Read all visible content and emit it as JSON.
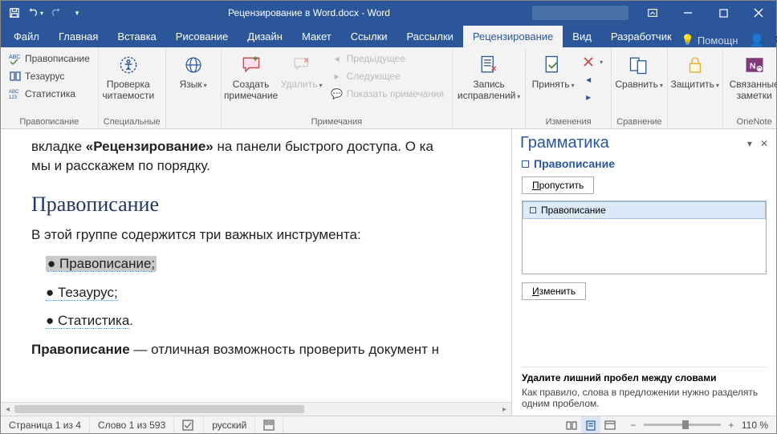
{
  "title": "Рецензирование в Word.docx - Word",
  "menutabs": [
    "Файл",
    "Главная",
    "Вставка",
    "Рисование",
    "Дизайн",
    "Макет",
    "Ссылки",
    "Рассылки",
    "Рецензирование",
    "Вид",
    "Разработчик"
  ],
  "active_tab": "Рецензирование",
  "tell_me": "Помощн",
  "ribbon": {
    "g1": {
      "spelling": "Правописание",
      "thesaurus": "Тезаурус",
      "stats": "Статистика",
      "label": "Правописание"
    },
    "g2": {
      "btn": "Проверка читаемости",
      "label": "Специальные"
    },
    "g3": {
      "btn": "Язык"
    },
    "g4": {
      "new": "Создать примечание",
      "del": "Удалить",
      "prev": "Предыдущее",
      "next": "Следующее",
      "show": "Показать примечания",
      "label": "Примечания"
    },
    "g5": {
      "track": "Запись исправлений"
    },
    "g6": {
      "accept": "Принять",
      "label": "Изменения"
    },
    "g7": {
      "compare": "Сравнить",
      "label": "Сравнение"
    },
    "g8": {
      "protect": "Защитить"
    },
    "g9": {
      "onenote": "Связанные заметки",
      "label": "OneNote"
    }
  },
  "document": {
    "line1a": "вкладке ",
    "line1b": "«Рецензирование»",
    "line1c": " на панели быстрого доступа. О ка",
    "line2": "мы и расскажем по порядку.",
    "h2": "Правописание",
    "p2": "В этой группе содержится три важных инструмента:",
    "li1": "Правописание;",
    "li2": "Тезаурус;",
    "li3": "Статистика",
    "p3a": "Правописание",
    "p3b": " — отличная возможность проверить документ н"
  },
  "pane": {
    "title": "Грамматика",
    "sub": "Правописание",
    "skip": "Пропустить",
    "option": "Правописание",
    "change": "Изменить",
    "exp_title": "Удалите лишний пробел между словами",
    "exp_desc": "Как правило, слова в предложении нужно разделять одним пробелом."
  },
  "status": {
    "page": "Страница 1 из 4",
    "words": "Слово 1 из 593",
    "lang": "русский",
    "zoom": "110 %"
  }
}
